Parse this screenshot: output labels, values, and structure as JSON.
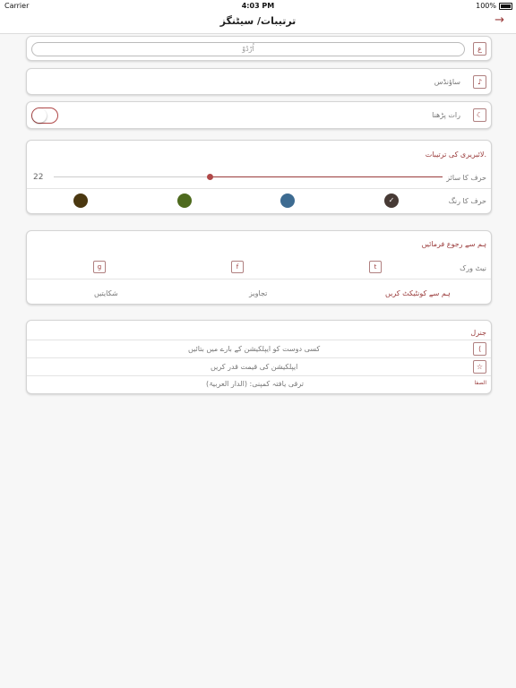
{
  "status_bar": {
    "carrier": "Carrier",
    "time": "4:03 PM",
    "battery": "100%"
  },
  "nav": {
    "title": "ترتیبات/ سیٹنگز",
    "back_icon": "→"
  },
  "language_card": {
    "input_value": "اُرْدُوْ"
  },
  "sounds_card": {
    "label": "ساؤنڈس"
  },
  "night_card": {
    "label": "رات پڑھنا",
    "toggle_on": false
  },
  "library_card": {
    "heading": "لائبریری کی ترتیبات.",
    "font_size_label": "حرف کا سائز",
    "font_size_value": "22",
    "slider_fraction": 0.4,
    "font_color_label": "حرف کا رنگ",
    "colors": [
      "#473a35",
      "#3d6b91",
      "#4e6a1e",
      "#4b3810"
    ],
    "selected_color_index": 0
  },
  "contact_card": {
    "heading": "ہم سے رجوع فرمائیں",
    "network_label": "نیٹ ورک",
    "social": [
      "twitter",
      "facebook",
      "google-plus"
    ],
    "tabs": [
      "ہم سے کونٹیکٹ کریں",
      "تجاویز",
      "شکایتیں"
    ]
  },
  "general_card": {
    "heading": "جنرل",
    "items": [
      "کسی دوست کو ایپلکیشن کے بارے میں بتائیں",
      "ایپلکیشن کی قیمت قدر کریں",
      "ترقی یافتہ کمپنی: (الدار العربیۃ)"
    ],
    "logo_text": "الصفا"
  },
  "colors": {
    "accent": "#9a3b3b"
  }
}
